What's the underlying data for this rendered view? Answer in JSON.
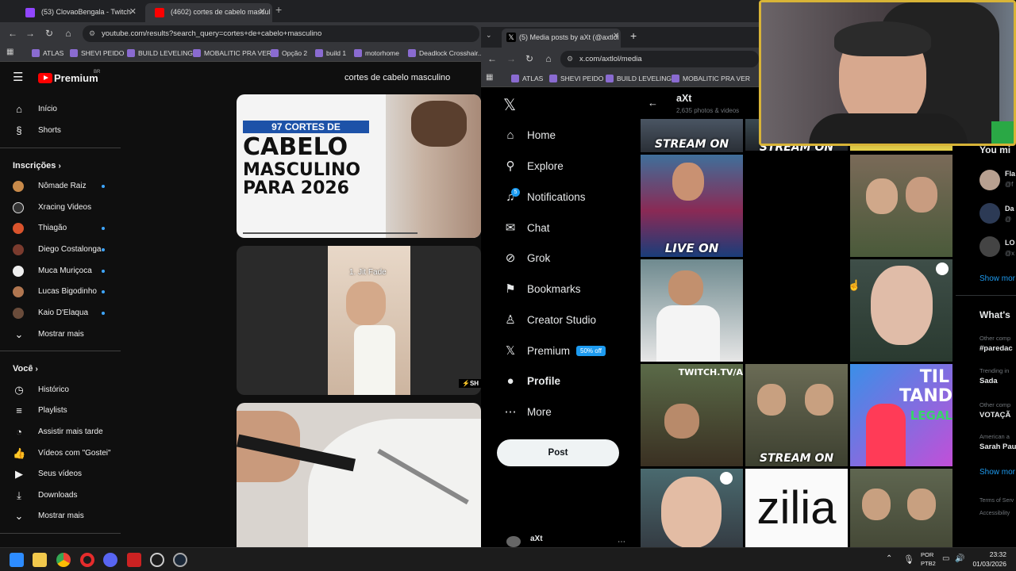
{
  "chrome": {
    "tabs": [
      {
        "label": "(53) ClovaoBengala - Twitch"
      },
      {
        "label": "(4602) cortes de cabelo mascul"
      }
    ],
    "url": "youtube.com/results?search_query=cortes+de+cabelo+masculino",
    "bookmarks": [
      "ATLAS",
      "SHEVI PEIDO",
      "BUILD LEVELING",
      "MOBALITIC PRA VER",
      "Opção 2",
      "build 1",
      "motorhome",
      "Deadlock Crosshair..."
    ]
  },
  "youtube": {
    "logo": "Premium",
    "region": "BR",
    "search_value": "cortes de cabelo masculino",
    "nav": [
      {
        "label": "Início",
        "icon": "home-icon"
      },
      {
        "label": "Shorts",
        "icon": "shorts-icon"
      }
    ],
    "subs_title": "Inscrições",
    "subs": [
      {
        "label": "Nômade Raiz",
        "color": "#c88a4a",
        "dot": true
      },
      {
        "label": "Xracing Videos",
        "color": "#dddddd",
        "dot": false
      },
      {
        "label": "Thiagão",
        "color": "#d9532c",
        "dot": true
      },
      {
        "label": "Diego Costalonga",
        "color": "#7a3b2e",
        "dot": true
      },
      {
        "label": "Muca Muriçoca",
        "color": "#eeeeee",
        "dot": true
      },
      {
        "label": "Lucas Bigodinho",
        "color": "#b07650",
        "dot": true
      },
      {
        "label": "Kaio D'Elaqua",
        "color": "#6a4c3b",
        "dot": true
      }
    ],
    "show_more": "Mostrar mais",
    "you_title": "Você",
    "you_items": [
      {
        "label": "Histórico",
        "icon": "history-icon"
      },
      {
        "label": "Playlists",
        "icon": "playlists-icon"
      },
      {
        "label": "Assistir mais tarde",
        "icon": "watch-later-icon"
      },
      {
        "label": "Vídeos com \"Gostei\"",
        "icon": "like-icon"
      },
      {
        "label": "Seus vídeos",
        "icon": "your-videos-icon"
      },
      {
        "label": "Downloads",
        "icon": "download-icon"
      }
    ],
    "show_more_2": "Mostrar mais",
    "thumb1": {
      "badge": "97 CORTES DE",
      "line1": "CABELO",
      "line2": "MASCULINO",
      "line3": "PARA 2026"
    },
    "thumb2": {
      "caption": "1. Jit Fade",
      "shorts_badge": "SH"
    }
  },
  "x_browser": {
    "tab_label": "(5) Media posts by aXt (@axtlol",
    "url": "x.com/axtlol/media",
    "bookmarks": [
      "ATLAS",
      "SHEVI PEIDO",
      "BUILD LEVELING",
      "MOBALITIC PRA VER"
    ]
  },
  "x": {
    "nav": [
      {
        "label": "Home",
        "icon": "home-icon"
      },
      {
        "label": "Explore",
        "icon": "search-icon"
      },
      {
        "label": "Notifications",
        "icon": "bell-icon",
        "badge": "5"
      },
      {
        "label": "Chat",
        "icon": "mail-icon"
      },
      {
        "label": "Grok",
        "icon": "grok-icon"
      },
      {
        "label": "Bookmarks",
        "icon": "bookmark-icon"
      },
      {
        "label": "Creator Studio",
        "icon": "creator-studio-icon"
      },
      {
        "label": "Premium",
        "icon": "x-logo-icon",
        "badge": "50% off"
      },
      {
        "label": "Profile",
        "icon": "person-icon"
      },
      {
        "label": "More",
        "icon": "more-icon"
      }
    ],
    "post_button": "Post",
    "account_name": "aXt",
    "profile_name": "aXt",
    "profile_sub": "2,635 photos & videos",
    "media_labels": {
      "stream_on_1": "STREAM ON",
      "stream_on_2": "STREAM ON",
      "live_on": "LIVE ON",
      "twitch": "TWITCH.TV/A",
      "stream_on_3": "STREAM ON",
      "til": "TIL",
      "tand": "TAND",
      "legal": "LEGAL",
      "zilia": "zilia"
    },
    "right": {
      "you_might": "You mi",
      "people": [
        {
          "name": "Fla",
          "handle": "@f"
        },
        {
          "name": "Da",
          "handle": "@"
        },
        {
          "name": "LO",
          "handle": "@x"
        }
      ],
      "show_more": "Show mor",
      "whats": "What's",
      "trends": [
        {
          "context": "Other comp",
          "name": "#paredac"
        },
        {
          "context": "Trending in",
          "name": "Sada"
        },
        {
          "context": "Other comp",
          "name": "VOTAÇÃ"
        },
        {
          "context": "American a",
          "name": "Sarah Pau"
        }
      ],
      "show_more_2": "Show mor",
      "terms": "Terms of Serv",
      "access": "Accessibility"
    }
  },
  "taskbar": {
    "lang1": "POR",
    "lang2": "PTB2",
    "time": "23:32",
    "date": "01/03/2026"
  }
}
